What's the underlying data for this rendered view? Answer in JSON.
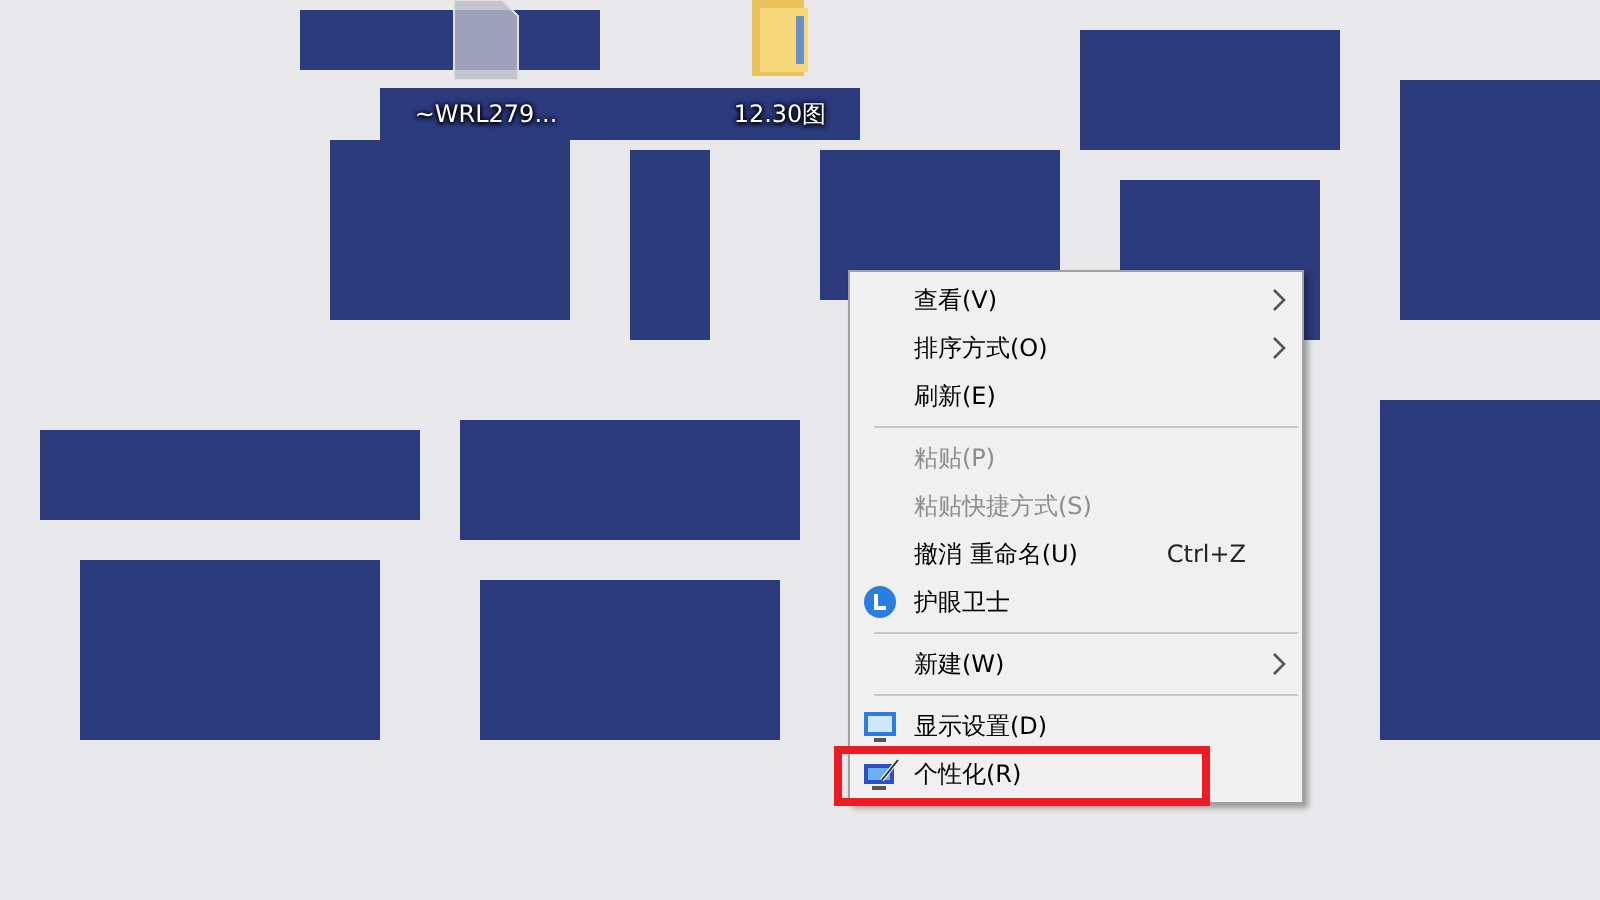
{
  "desktop_icons": [
    {
      "kind": "file",
      "label": "~WRL279..."
    },
    {
      "kind": "folder",
      "label": "12.30图"
    }
  ],
  "context_menu": {
    "items": [
      {
        "kind": "plain",
        "label": "查看(V)",
        "submenu": true,
        "disabled": false,
        "highlighted": false
      },
      {
        "kind": "plain",
        "label": "排序方式(O)",
        "submenu": true,
        "disabled": false,
        "highlighted": false
      },
      {
        "kind": "plain",
        "label": "刷新(E)",
        "submenu": false,
        "disabled": false,
        "highlighted": false
      },
      {
        "kind": "separator"
      },
      {
        "kind": "plain",
        "label": "粘贴(P)",
        "submenu": false,
        "disabled": true,
        "highlighted": false
      },
      {
        "kind": "plain",
        "label": "粘贴快捷方式(S)",
        "submenu": false,
        "disabled": true,
        "highlighted": false
      },
      {
        "kind": "plain",
        "label": "撤消 重命名(U)",
        "shortcut": "Ctrl+Z",
        "submenu": false,
        "disabled": false,
        "highlighted": false
      },
      {
        "kind": "clock-item",
        "label": "护眼卫士",
        "submenu": false,
        "disabled": false,
        "highlighted": false
      },
      {
        "kind": "separator"
      },
      {
        "kind": "plain",
        "label": "新建(W)",
        "submenu": true,
        "disabled": false,
        "highlighted": false
      },
      {
        "kind": "separator"
      },
      {
        "kind": "display-item",
        "label": "显示设置(D)",
        "submenu": false,
        "disabled": false,
        "highlighted": false
      },
      {
        "kind": "personalize-item",
        "label": "个性化(R)",
        "submenu": false,
        "disabled": false,
        "highlighted": true
      }
    ]
  }
}
